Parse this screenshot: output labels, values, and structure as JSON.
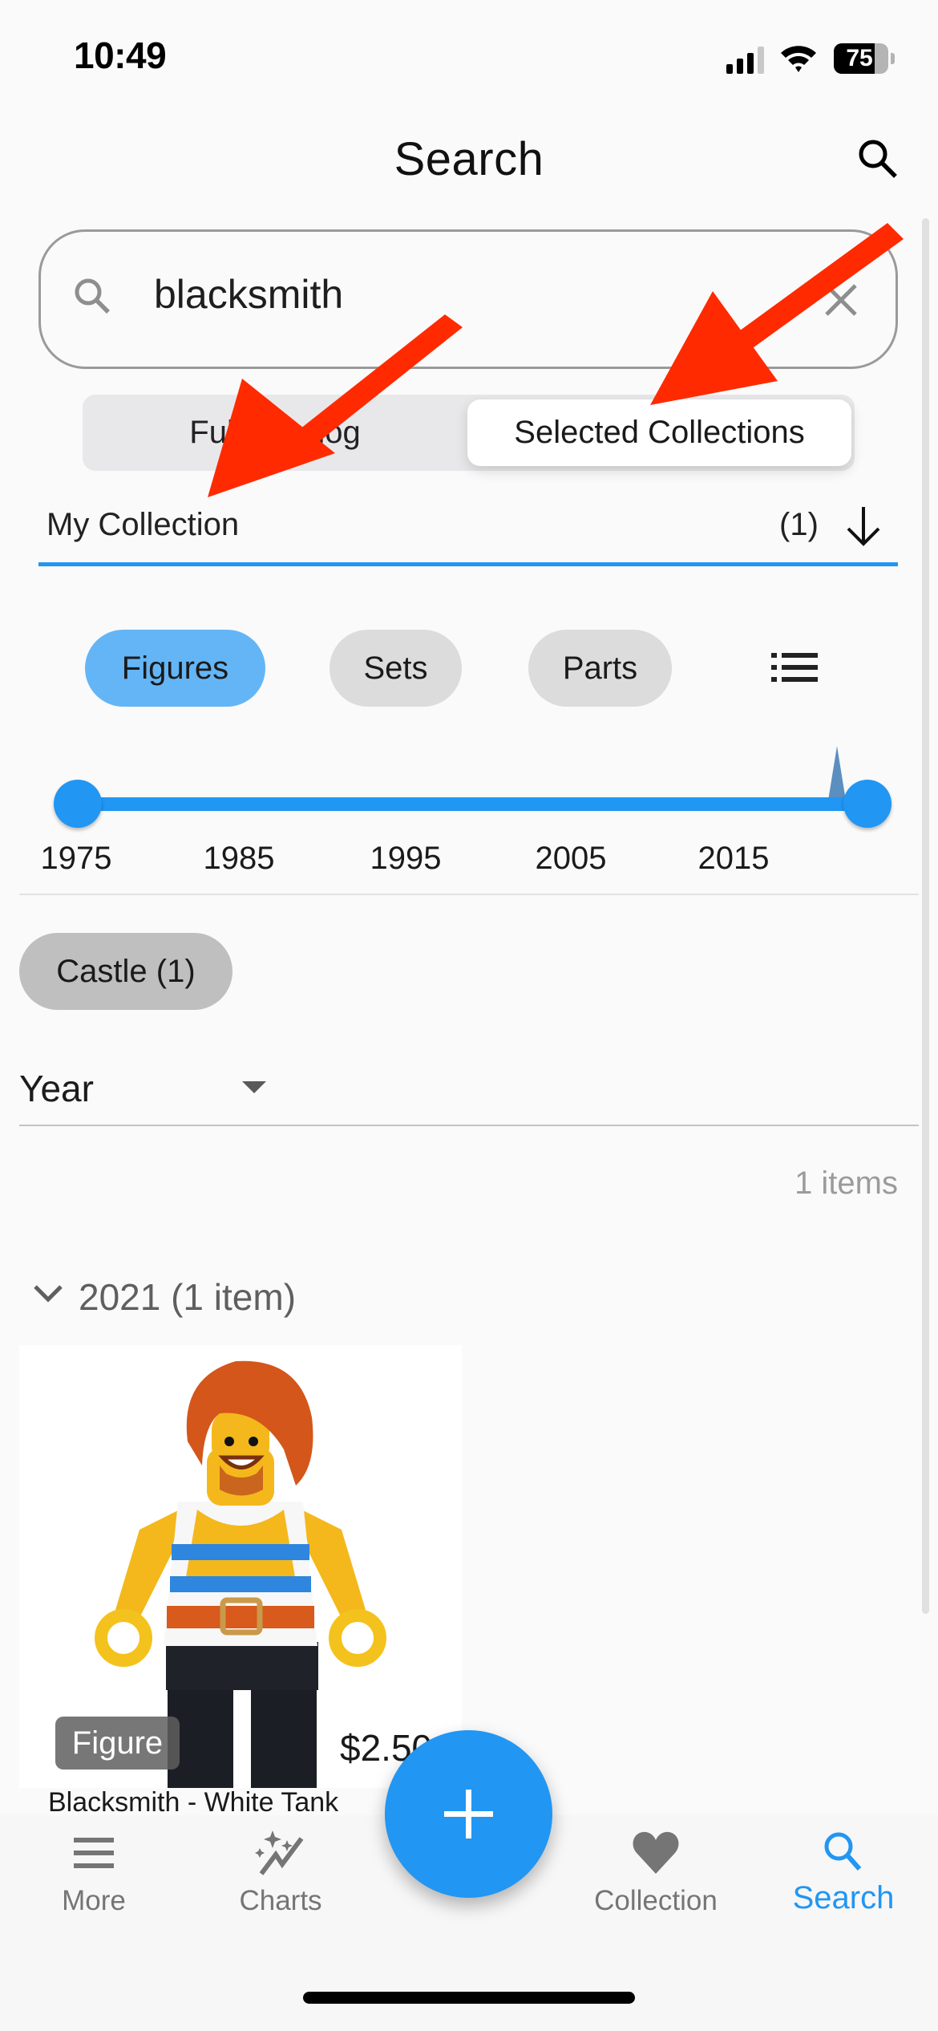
{
  "status_bar": {
    "time": "10:49",
    "battery_percent": "75",
    "battery_level": 0.75,
    "signal_bars_active": 3,
    "signal_bars_total": 4,
    "icons": [
      "signal-icon",
      "wifi-icon",
      "battery-icon"
    ]
  },
  "header": {
    "title": "Search",
    "action_icon": "search-icon"
  },
  "search": {
    "value": "blacksmith",
    "leading_icon": "search-icon",
    "clear_icon": "close-icon"
  },
  "scope_toggle": {
    "options": [
      "Full Catalog",
      "Selected Collections"
    ],
    "selected": "Selected Collections"
  },
  "collection_selector": {
    "label": "My Collection",
    "count": "(1)",
    "icon": "arrow-down-icon"
  },
  "type_filter": {
    "options": [
      {
        "label": "Figures",
        "selected": true
      },
      {
        "label": "Sets",
        "selected": false
      },
      {
        "label": "Parts",
        "selected": false
      }
    ],
    "view_icon": "list-icon"
  },
  "year_slider": {
    "min": 1975,
    "max": 2023,
    "range_low": 1975,
    "range_high": 2023,
    "tick_labels": [
      "1975",
      "1985",
      "1995",
      "2005",
      "2015"
    ],
    "histogram_peak_year": 2021
  },
  "theme_filters": [
    {
      "label": "Castle (1)"
    }
  ],
  "sort": {
    "selected": "Year"
  },
  "results": {
    "count_label": "1 items",
    "groups": [
      {
        "label": "2021 (1 item)",
        "expanded": true,
        "items": [
          {
            "type_badge": "Figure",
            "price": "$2.50",
            "name": "Blacksmith - White Tank"
          }
        ]
      }
    ]
  },
  "fab": {
    "icon": "plus-icon"
  },
  "bottom_nav": {
    "items": [
      {
        "label": "More",
        "icon": "menu-icon",
        "active": false
      },
      {
        "label": "Charts",
        "icon": "charts-icon",
        "active": false
      },
      {
        "label": "Collection",
        "icon": "heart-icon",
        "active": false
      },
      {
        "label": "Search",
        "icon": "search-icon",
        "active": true
      }
    ]
  },
  "colors": {
    "accent": "#2196f3",
    "chip_selected": "#64b5f6",
    "chip_default": "#dcdcdc",
    "theme_chip": "#bfbfbf",
    "annotation_arrow": "#ff2a00",
    "background": "#fafafa"
  }
}
